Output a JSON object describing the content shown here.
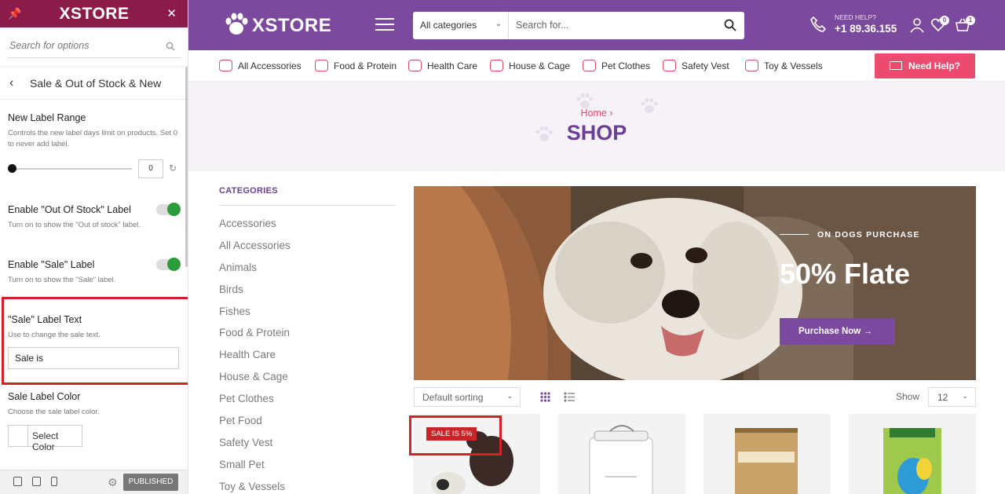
{
  "customizer": {
    "brand": "XSTORE",
    "search_placeholder": "Search for options",
    "section_title": "Sale & Out of Stock & New",
    "new_label": {
      "title": "New Label Range",
      "desc": "Controls the new label days limit on products. Set 0 to never add label.",
      "value": "0"
    },
    "out_of_stock": {
      "title": "Enable \"Out Of Stock\" Label",
      "desc": "Turn on to show the \"Out of stock\" label.",
      "enabled": true
    },
    "sale_label": {
      "title": "Enable \"Sale\" Label",
      "desc": "Turn on to show the \"Sale\" label.",
      "enabled": true
    },
    "sale_text": {
      "title": "\"Sale\" Label Text",
      "desc": "Use to change the sale text.",
      "value": "Sale is"
    },
    "sale_color": {
      "title": "Sale Label Color",
      "desc": "Choose the sale label color.",
      "button": "Select Color"
    },
    "publish_label": "PUBLISHED"
  },
  "header": {
    "brand": "XSTORE",
    "category_select": "All categories",
    "search_placeholder": "Search for...",
    "help_small": "NEED HELP?",
    "help_phone": "+1 89.36.155",
    "wishlist_count": "0",
    "cart_count": "1"
  },
  "nav": {
    "items": [
      "All Accessories",
      "Food & Protein",
      "Health Care",
      "House & Cage",
      "Pet Clothes",
      "Safety Vest",
      "Toy & Vessels"
    ],
    "help_button": "Need Help?"
  },
  "banner": {
    "breadcrumb": "Home",
    "title": "SHOP"
  },
  "categories": {
    "title": "CATEGORIES",
    "items": [
      "Accessories",
      "All Accessories",
      "Animals",
      "Birds",
      "Fishes",
      "Food & Protein",
      "Health Care",
      "House & Cage",
      "Pet Clothes",
      "Pet Food",
      "Safety Vest",
      "Small Pet",
      "Toy & Vessels"
    ]
  },
  "hero": {
    "subtitle": "ON DOGS PURCHASE",
    "headline": "50% Flate",
    "button": "Purchase Now"
  },
  "toolbar": {
    "sorting": "Default sorting",
    "show_label": "Show",
    "show_value": "12"
  },
  "products": {
    "sale_badge": "SALE IS 5%"
  },
  "colors": {
    "brand_purple": "#7b4a9e",
    "customizer_header": "#8b1c4a",
    "accent_pink": "#ec4b6f",
    "toggle_on": "#2a9d3a",
    "sale_red": "#c72528",
    "highlight_red": "#d4202a"
  }
}
